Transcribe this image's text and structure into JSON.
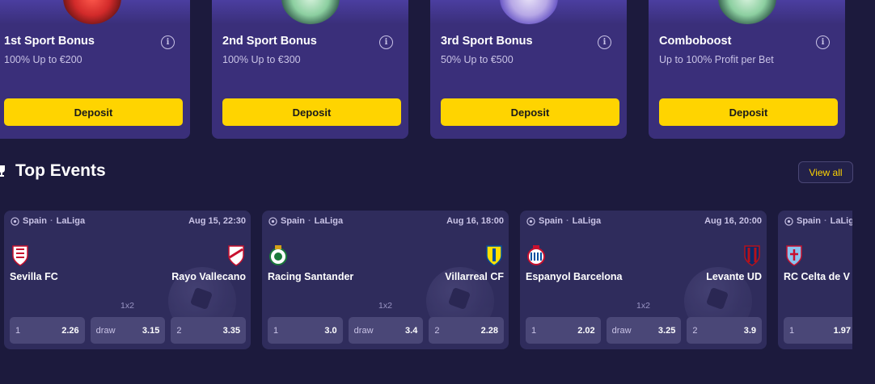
{
  "bonuses": [
    {
      "title": "1st Sport Bonus",
      "subtitle": "100% Up to €200",
      "button": "Deposit"
    },
    {
      "title": "2nd Sport Bonus",
      "subtitle": "100% Up to €300",
      "button": "Deposit"
    },
    {
      "title": "3rd Sport Bonus",
      "subtitle": "50% Up to €500",
      "button": "Deposit"
    },
    {
      "title": "Comboboost",
      "subtitle": "Up to 100% Profit per Bet",
      "button": "Deposit"
    }
  ],
  "top_events": {
    "title": "Top Events",
    "view_all": "View all"
  },
  "events": [
    {
      "country": "Spain",
      "league": "LaLiga",
      "date": "Aug 15, 22:30",
      "home": "Sevilla FC",
      "away": "Rayo Vallecano",
      "market": "1x2",
      "odds": [
        {
          "label": "1",
          "value": "2.26"
        },
        {
          "label": "draw",
          "value": "3.15"
        },
        {
          "label": "2",
          "value": "3.35"
        }
      ]
    },
    {
      "country": "Spain",
      "league": "LaLiga",
      "date": "Aug 16, 18:00",
      "home": "Racing Santander",
      "away": "Villarreal CF",
      "market": "1x2",
      "odds": [
        {
          "label": "1",
          "value": "3.0"
        },
        {
          "label": "draw",
          "value": "3.4"
        },
        {
          "label": "2",
          "value": "2.28"
        }
      ]
    },
    {
      "country": "Spain",
      "league": "LaLiga",
      "date": "Aug 16, 20:00",
      "home": "Espanyol Barcelona",
      "away": "Levante UD",
      "market": "1x2",
      "odds": [
        {
          "label": "1",
          "value": "2.02"
        },
        {
          "label": "draw",
          "value": "3.25"
        },
        {
          "label": "2",
          "value": "3.9"
        }
      ]
    },
    {
      "country": "Spain",
      "league": "LaLig",
      "home": "RC Celta de V",
      "odds": [
        {
          "label": "1",
          "value": "1.97"
        }
      ]
    }
  ],
  "colors": {
    "background": "#1c1a3d",
    "card": "#3a2f7a",
    "event_card": "#2f2c5c",
    "accent": "#ffd400"
  }
}
